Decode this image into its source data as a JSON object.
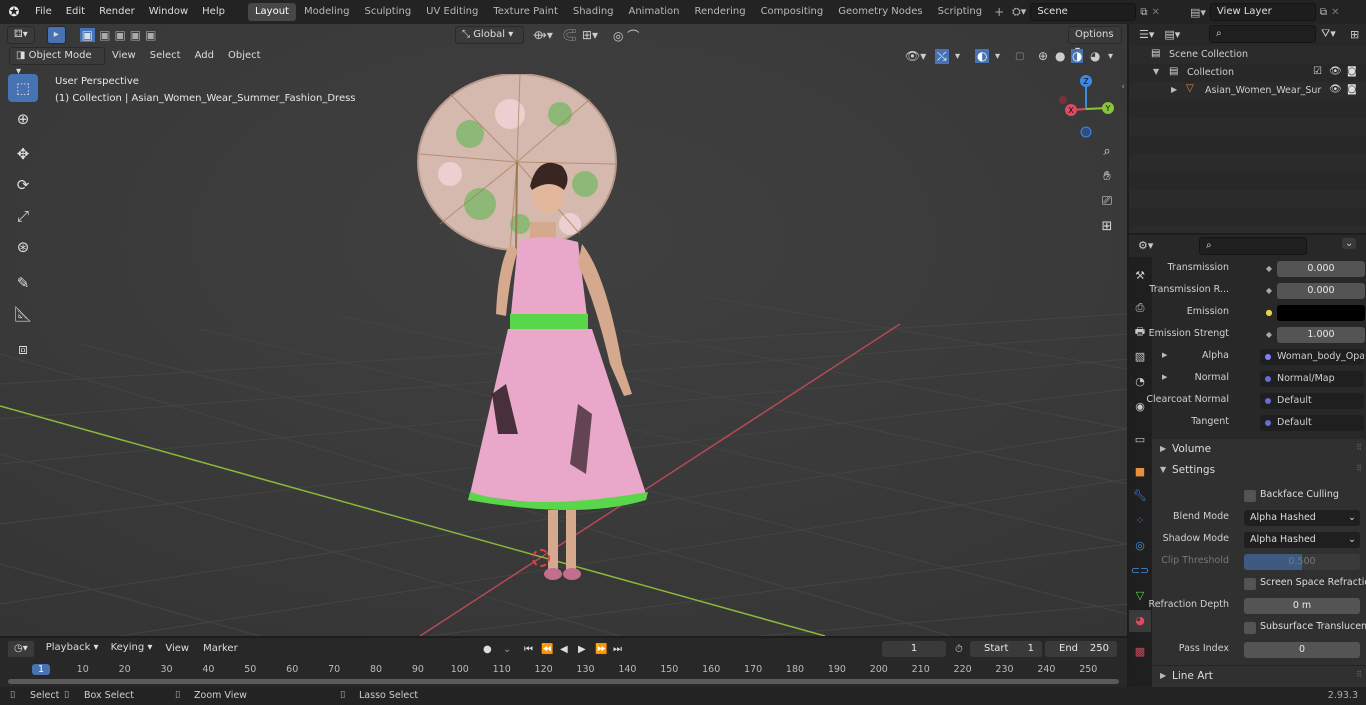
{
  "menu": {
    "file": "File",
    "edit": "Edit",
    "render": "Render",
    "window": "Window",
    "help": "Help"
  },
  "workspaces": [
    "Layout",
    "Modeling",
    "Sculpting",
    "UV Editing",
    "Texture Paint",
    "Shading",
    "Animation",
    "Rendering",
    "Compositing",
    "Geometry Nodes",
    "Scripting"
  ],
  "scene": "Scene",
  "view_layer": "View Layer",
  "viewport": {
    "orientation": "Global",
    "options": "Options",
    "mode": "Object Mode",
    "menu_view": "View",
    "menu_select": "Select",
    "menu_add": "Add",
    "menu_object": "Object",
    "perspective": "User Perspective",
    "collection_info": "(1) Collection | Asian_Women_Wear_Summer_Fashion_Dress",
    "gizmo": {
      "x": "X",
      "y": "Y",
      "z": "Z"
    }
  },
  "outliner": {
    "scene_collection": "Scene Collection",
    "collection": "Collection",
    "object": "Asian_Women_Wear_Sur"
  },
  "properties": {
    "transmission_label": "Transmission",
    "transmission_value": "0.000",
    "transmission_r_label": "Transmission R...",
    "transmission_r_value": "0.000",
    "emission_label": "Emission",
    "emission_strength_label": "Emission Strengt",
    "emission_strength_value": "1.000",
    "alpha_label": "Alpha",
    "alpha_value": "Woman_body_Opac...",
    "normal_label": "Normal",
    "normal_value": "Normal/Map",
    "clearcoat_normal_label": "Clearcoat Normal",
    "clearcoat_normal_value": "Default",
    "tangent_label": "Tangent",
    "tangent_value": "Default",
    "volume_panel": "Volume",
    "settings_panel": "Settings",
    "backface_culling": "Backface Culling",
    "blend_mode_label": "Blend Mode",
    "blend_mode_value": "Alpha Hashed",
    "shadow_mode_label": "Shadow Mode",
    "shadow_mode_value": "Alpha Hashed",
    "clip_threshold_label": "Clip Threshold",
    "clip_threshold_value": "0.500",
    "screen_space_refraction": "Screen Space Refraction",
    "refraction_depth_label": "Refraction Depth",
    "refraction_depth_value": "0 m",
    "subsurface_translucency": "Subsurface Translucency",
    "pass_index_label": "Pass Index",
    "pass_index_value": "0",
    "line_art_panel": "Line Art"
  },
  "timeline": {
    "playback": "Playback",
    "keying": "Keying",
    "view": "View",
    "marker": "Marker",
    "current_frame": "1",
    "start_label": "Start",
    "start_value": "1",
    "end_label": "End",
    "end_value": "250",
    "ticks": [
      "1",
      "10",
      "20",
      "30",
      "40",
      "50",
      "60",
      "70",
      "80",
      "90",
      "100",
      "110",
      "120",
      "130",
      "140",
      "150",
      "160",
      "170",
      "180",
      "190",
      "200",
      "210",
      "220",
      "230",
      "240",
      "250"
    ]
  },
  "status": {
    "select": "Select",
    "box_select": "Box Select",
    "zoom_view": "Zoom View",
    "lasso_select": "Lasso Select",
    "version": "2.93.3"
  },
  "colors": {
    "accent": "#4772b3",
    "x_axis": "#e04a5f",
    "y_axis": "#8ac43a",
    "z_axis": "#3c8ae6",
    "emission": "#000000",
    "dress": "#e9a7c9",
    "bow": "#5ad64a"
  }
}
